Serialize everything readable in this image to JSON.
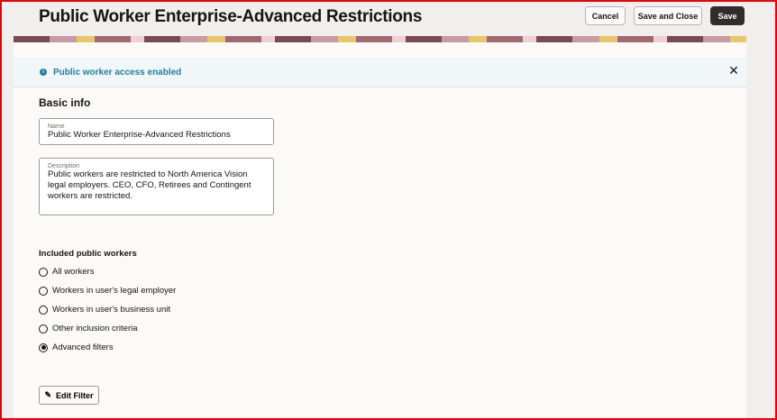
{
  "header": {
    "title": "Public Worker Enterprise-Advanced Restrictions",
    "cancel": "Cancel",
    "save_close": "Save and Close",
    "save": "Save"
  },
  "message": {
    "text": "Public worker access enabled"
  },
  "basic": {
    "heading": "Basic info",
    "name_label": "Name",
    "name_value": "Public Worker Enterprise-Advanced Restrictions",
    "desc_label": "Description",
    "desc_value": "Public workers are restricted to North America Vision legal employers.  CEO, CFO, Retirees and Contingent workers are restricted."
  },
  "included": {
    "heading": "Included public workers",
    "options": [
      {
        "label": "All workers"
      },
      {
        "label": "Workers in user's legal employer"
      },
      {
        "label": "Workers in user's business unit"
      },
      {
        "label": "Other inclusion criteria"
      },
      {
        "label": "Advanced filters"
      }
    ],
    "selected": "Advanced filters"
  },
  "edit_filter": "Edit Filter"
}
